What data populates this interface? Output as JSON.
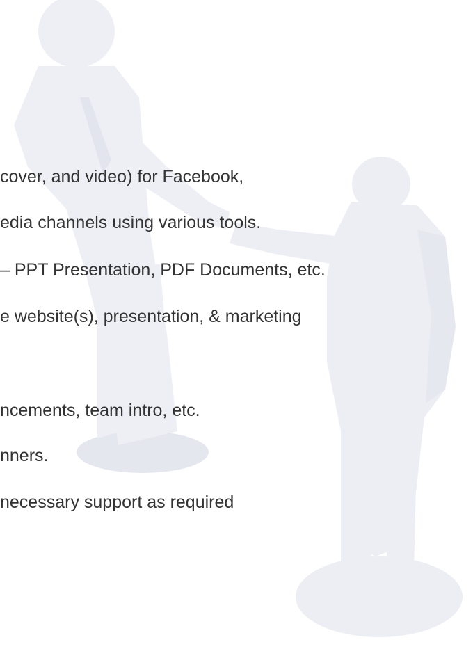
{
  "background": {
    "illustration_icon": "handshake-businessmen-illustration",
    "figure_color": "#ecedf4",
    "shadow_color": "#e3e5ee"
  },
  "text_color": "#333333",
  "lines": [
    "cover, and video) for Facebook,",
    "edia channels using various tools.",
    "– PPT Presentation, PDF Documents, etc.",
    "e website(s), presentation, & marketing",
    "ncements, team intro, etc.",
    "nners.",
    "necessary support as required"
  ]
}
